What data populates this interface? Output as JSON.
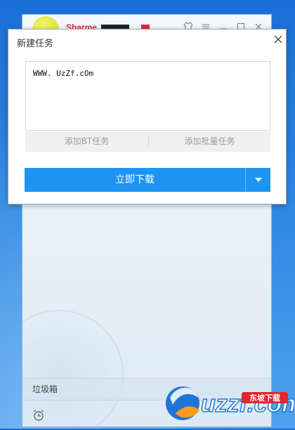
{
  "app": {
    "username": "Sharme",
    "trash_label": "垃圾箱"
  },
  "dialog": {
    "title": "新建任务",
    "url_value": "WWW. UzZf.cOm",
    "add_bt_label": "添加BT任务",
    "add_batch_label": "添加批量任务",
    "download_label": "立即下载"
  },
  "watermark": {
    "text": "uzzf.com",
    "subtext": "东坡下载"
  },
  "icons": {
    "close": "close-icon",
    "dropdown": "chevron-down-icon",
    "clock": "alarm-clock-icon",
    "skin": "shirt-icon",
    "menu": "menu-icon",
    "minimize": "minimize-icon",
    "maximize": "maximize-icon"
  },
  "colors": {
    "accent": "#1e94f2",
    "desktop": "#2c86e3",
    "username": "#e2262d"
  }
}
